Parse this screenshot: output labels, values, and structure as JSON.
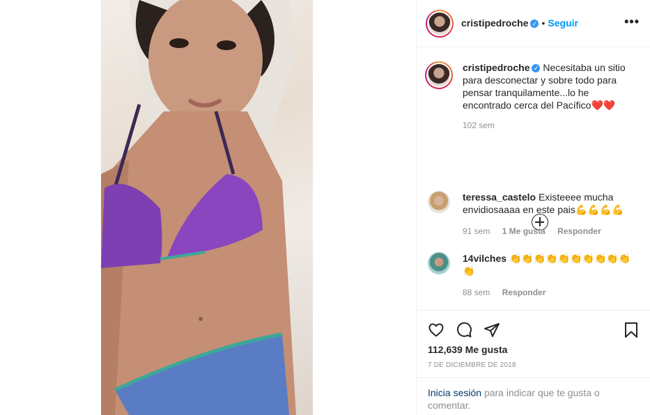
{
  "post": {
    "author": "cristipedroche",
    "follow_label": "Seguir",
    "more_label": "•••",
    "caption": "Necesitaba un sitio para desconectar y sobre todo para pensar tranquilamente...lo he encontrado cerca del Pacífico❤️❤️",
    "caption_time": "102 sem",
    "likes": "112,639 Me gusta",
    "date": "7 DE DICIEMBRE DE 2018"
  },
  "comments": [
    {
      "user": "teressa_castelo",
      "text": "Existeeee mucha envidiosaaaa en este pais💪💪💪💪",
      "time": "91 sem",
      "likes": "1 Me gusta",
      "reply": "Responder"
    },
    {
      "user": "14vilches",
      "text": "👏👏👏👏👏👏👏👏👏👏👏",
      "time": "88 sem",
      "reply": "Responder"
    }
  ],
  "login": {
    "link": "Inicia sesión",
    "rest": "para indicar que te gusta o comentar."
  },
  "icons": {
    "like": "heart-icon",
    "comment": "comment-icon",
    "share": "share-icon",
    "save": "bookmark-icon",
    "expand": "plus-circle-icon",
    "verified": "verified-badge-icon"
  },
  "colors": {
    "link": "#0095f6",
    "verified": "#3897f0",
    "muted": "#8e8e8e"
  }
}
